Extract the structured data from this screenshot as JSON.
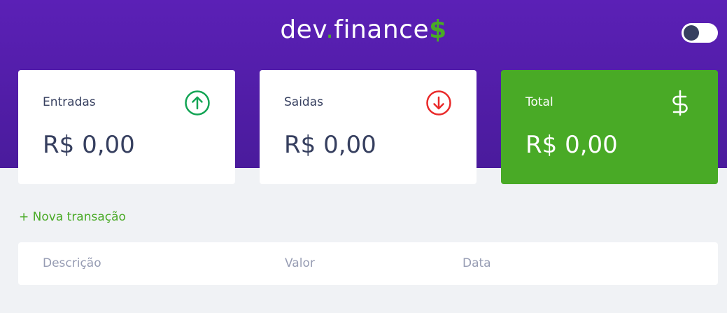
{
  "header": {
    "logo": {
      "part1": "dev",
      "dot": ".",
      "part2": "finance",
      "dollar": "$"
    },
    "theme_toggle": {
      "state": "off"
    }
  },
  "summary": {
    "income": {
      "label": "Entradas",
      "amount": "R$ 0,00",
      "icon": "arrow-up-circle-icon",
      "color": "#12a454"
    },
    "expense": {
      "label": "Saidas",
      "amount": "R$ 0,00",
      "icon": "arrow-down-circle-icon",
      "color": "#e92929"
    },
    "total": {
      "label": "Total",
      "amount": "R$ 0,00",
      "icon": "dollar-sign-icon",
      "color": "#49aa26"
    }
  },
  "actions": {
    "new_transaction": "+ Nova transação"
  },
  "table": {
    "columns": [
      "Descrição",
      "Valor",
      "Data"
    ],
    "rows": []
  },
  "colors": {
    "header_bg": "#5b20b6",
    "accent": "#49aa26",
    "page_bg": "#f0f2f5",
    "text": "#363f5f",
    "muted": "#969cb3"
  }
}
